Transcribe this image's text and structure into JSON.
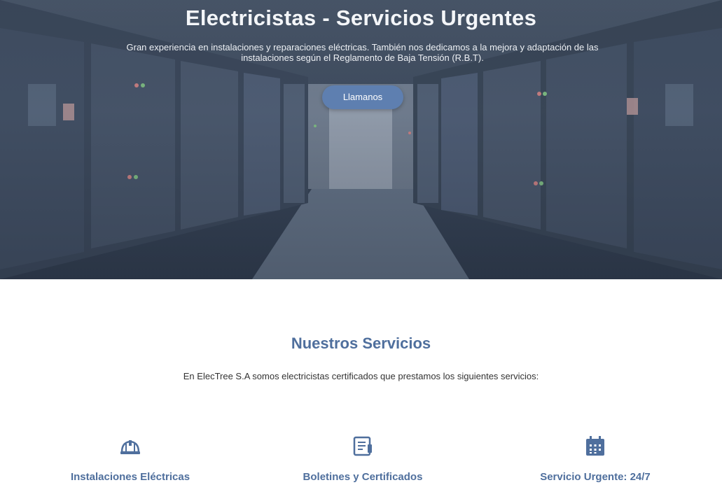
{
  "hero": {
    "title": "Electricistas - Servicios Urgentes",
    "subtitle": "Gran experiencia en instalaciones y reparaciones eléctricas. También nos dedicamos a la mejora y adaptación de las instalaciones según el Reglamento de Baja Tensión (R.B.T).",
    "cta_label": "Llamanos"
  },
  "services": {
    "title": "Nuestros Servicios",
    "description": "En ElecTree S.A somos electricistas certificados que prestamos los siguientes servicios:",
    "items": [
      {
        "label": "Instalaciones Eléctricas",
        "icon": "hard-hat-icon"
      },
      {
        "label": "Boletines y Certificados",
        "icon": "document-icon"
      },
      {
        "label": "Servicio Urgente: 24/7",
        "icon": "calendar-icon"
      }
    ]
  },
  "colors": {
    "accent": "#4f6f9d",
    "button": "#5e7fb0",
    "hero_overlay": "#3a475a"
  }
}
